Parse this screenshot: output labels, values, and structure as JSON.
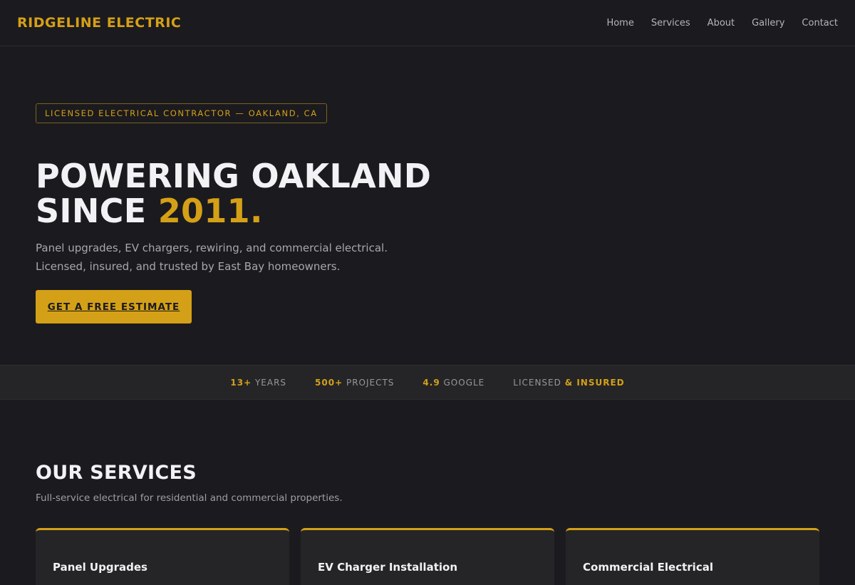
{
  "brand": {
    "name": "RIDGELINE ELECTRIC",
    "accent_color": "#d4a017",
    "background": "#1b1a1e"
  },
  "nav": {
    "links": [
      "Home",
      "Services",
      "About",
      "Gallery",
      "Contact"
    ]
  },
  "hero": {
    "tag": "LICENSED ELECTRICAL CONTRACTOR — OAKLAND, CA",
    "headline_line1": "POWERING OAKLAND",
    "headline_line2_prefix": "SINCE ",
    "headline_line2_accent": "2011.",
    "subtext_line1": "Panel upgrades, EV chargers, rewiring, and commercial electrical.",
    "subtext_line2": "Licensed, insured, and trusted by East Bay homeowners.",
    "cta_label": "GET A FREE ESTIMATE"
  },
  "stats": [
    {
      "num": "13+",
      "label": " YEARS"
    },
    {
      "num": "500+",
      "label": " PROJECTS"
    },
    {
      "num": "4.9",
      "label": " GOOGLE"
    },
    {
      "prefix": "LICENSED ",
      "num": "& INSURED"
    }
  ],
  "services": {
    "title": "OUR SERVICES",
    "subtitle": "Full-service electrical for residential and commercial properties.",
    "cards": [
      "Panel Upgrades",
      "EV Charger Installation",
      "Commercial Electrical"
    ]
  }
}
